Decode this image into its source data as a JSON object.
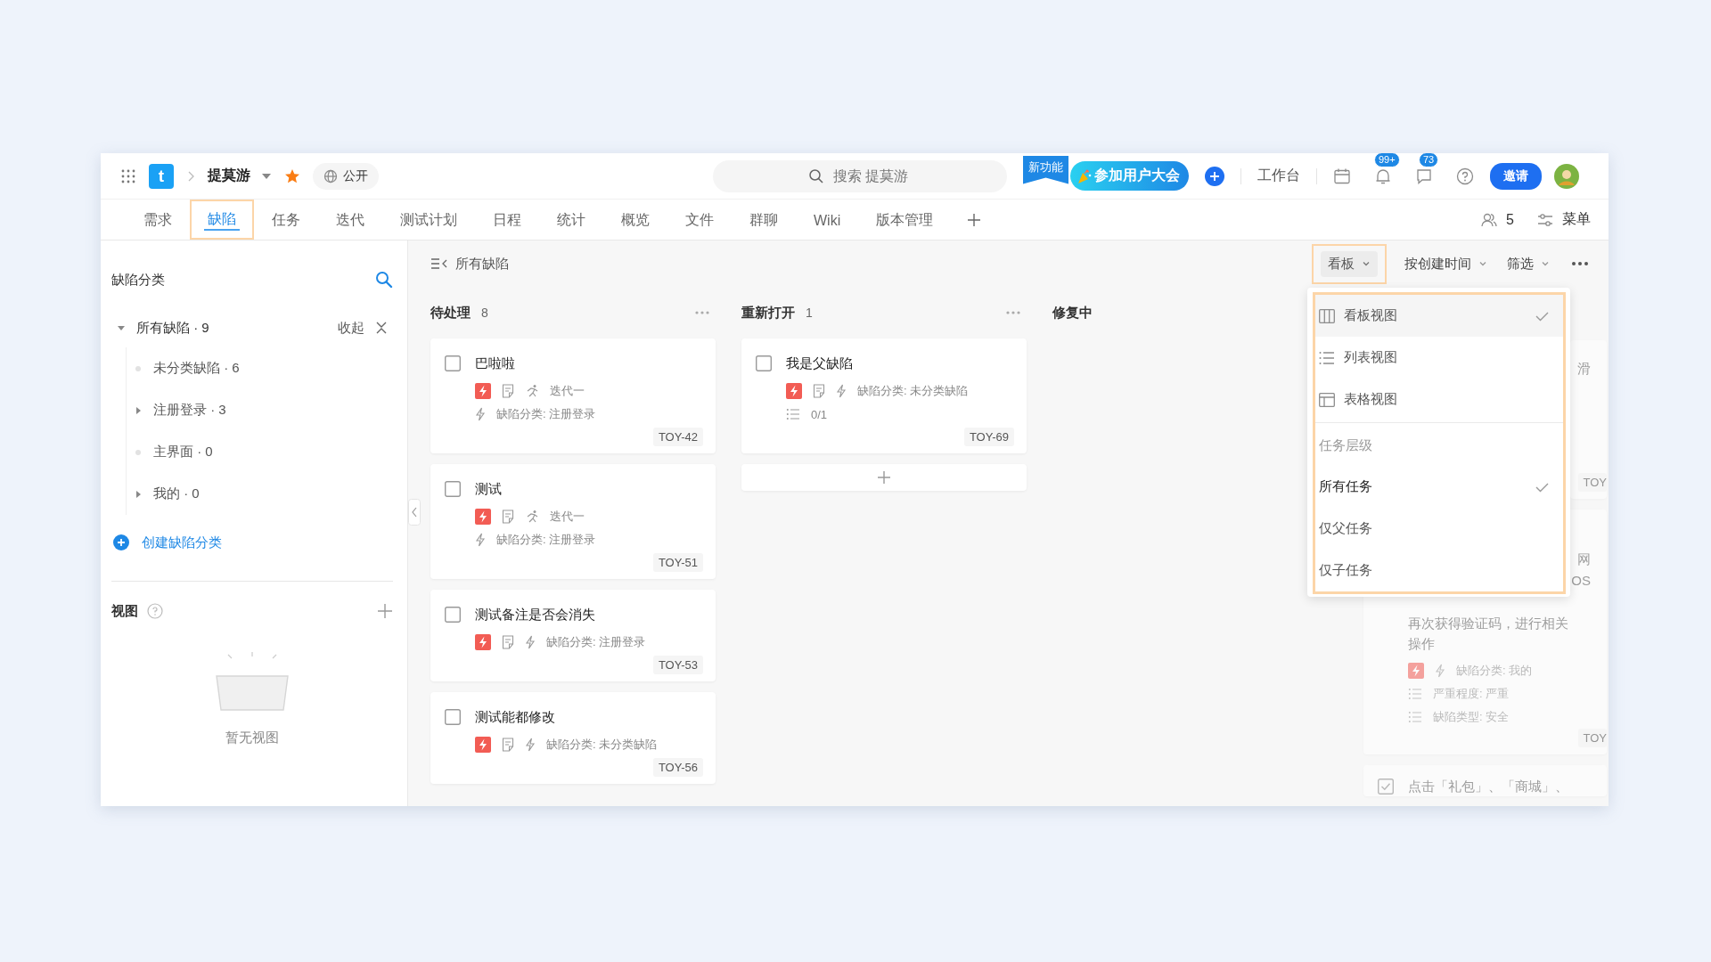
{
  "topbar": {
    "logo": "t",
    "project": "提莫游",
    "starred": true,
    "visibility": "公开",
    "search": {
      "placeholder": "搜索 提莫游"
    },
    "promo_ribbon": "新功能",
    "promo": "参加用户大会",
    "workbench": "工作台",
    "notifications": "99+",
    "messages": "73",
    "invite": "邀请"
  },
  "tabs": [
    {
      "label": "需求",
      "selected": false,
      "highlighted": false
    },
    {
      "label": "缺陷",
      "selected": true,
      "highlighted": true
    },
    {
      "label": "任务",
      "selected": false,
      "highlighted": false
    },
    {
      "label": "迭代",
      "selected": false,
      "highlighted": false
    },
    {
      "label": "测试计划",
      "selected": false,
      "highlighted": false
    },
    {
      "label": "日程",
      "selected": false,
      "highlighted": false
    },
    {
      "label": "统计",
      "selected": false,
      "highlighted": false
    },
    {
      "label": "概览",
      "selected": false,
      "highlighted": false
    },
    {
      "label": "文件",
      "selected": false,
      "highlighted": false
    },
    {
      "label": "群聊",
      "selected": false,
      "highlighted": false
    },
    {
      "label": "Wiki",
      "selected": false,
      "highlighted": false
    },
    {
      "label": "版本管理",
      "selected": false,
      "highlighted": false
    }
  ],
  "members": "5",
  "menu": "菜单",
  "sidebar": {
    "title": "缺陷分类",
    "collapse": "收起",
    "tree": [
      {
        "label": "所有缺陷 · 9",
        "expanded": true,
        "children": [
          {
            "label": "未分类缺陷 · 6"
          },
          {
            "label": "注册登录 · 3",
            "expanded": false
          },
          {
            "label": "主界面 · 0"
          },
          {
            "label": "我的 · 0",
            "expanded": false
          }
        ]
      }
    ],
    "create": "创建缺陷分类",
    "views_title": "视图",
    "views_empty": "暂无视图"
  },
  "board": {
    "title": "所有缺陷",
    "view_button": {
      "label": "看板",
      "highlighted": true
    },
    "sort": "按创建时间",
    "filter": "筛选",
    "columns": [
      {
        "title": "待处理",
        "count": "8",
        "cards": [
          {
            "title": "巴啦啦",
            "checked": false,
            "rows": [
              [
                {
                  "kind": "priority"
                },
                {
                  "kind": "doc"
                },
                {
                  "kind": "sprint",
                  "text": "迭代一"
                }
              ],
              [
                {
                  "kind": "category",
                  "text": "缺陷分类: 注册登录"
                }
              ]
            ],
            "id": "TOY-42"
          },
          {
            "title": "测试",
            "checked": false,
            "rows": [
              [
                {
                  "kind": "priority"
                },
                {
                  "kind": "doc"
                },
                {
                  "kind": "sprint",
                  "text": "迭代一"
                }
              ],
              [
                {
                  "kind": "category",
                  "text": "缺陷分类: 注册登录"
                }
              ]
            ],
            "id": "TOY-51"
          },
          {
            "title": "测试备注是否会消失",
            "checked": false,
            "rows": [
              [
                {
                  "kind": "priority"
                },
                {
                  "kind": "doc"
                },
                {
                  "kind": "category",
                  "text": "缺陷分类: 注册登录"
                }
              ]
            ],
            "id": "TOY-53"
          },
          {
            "title": "测试能都修改",
            "checked": false,
            "rows": [
              [
                {
                  "kind": "priority"
                },
                {
                  "kind": "doc"
                },
                {
                  "kind": "category",
                  "text": "缺陷分类: 未分类缺陷"
                }
              ]
            ],
            "id": "TOY-56"
          }
        ]
      },
      {
        "title": "重新打开",
        "count": "1",
        "add_button": true,
        "cards": [
          {
            "title": "我是父缺陷",
            "checked": false,
            "rows": [
              [
                {
                  "kind": "priority"
                },
                {
                  "kind": "doc"
                },
                {
                  "kind": "category",
                  "text": "缺陷分类: 未分类缺陷"
                }
              ],
              [
                {
                  "kind": "field",
                  "text": "0/1"
                }
              ]
            ],
            "id": "TOY-69"
          }
        ]
      },
      {
        "title": "修复中"
      },
      {
        "faded": true,
        "cards": [
          {
            "lines": [
              {
                "kind": "fragment",
                "text": "滑"
              }
            ],
            "id": "TOY"
          },
          {
            "lines": [
              {
                "kind": "fragment",
                "text": "网"
              },
              {
                "kind": "fragment",
                "text": "OS"
              },
              {
                "kind": "line",
                "text": "再次获得验证码，进行相关"
              },
              {
                "kind": "line",
                "text": "操作"
              }
            ],
            "rows": [
              [
                {
                  "kind": "priority"
                },
                {
                  "kind": "category",
                  "text": "缺陷分类: 我的"
                }
              ],
              [
                {
                  "kind": "field",
                  "text": "严重程度: 严重"
                }
              ],
              [
                {
                  "kind": "field",
                  "text": "缺陷类型: 安全"
                }
              ]
            ],
            "id": "TOY"
          },
          {
            "checked": true,
            "lines": [
              {
                "kind": "line",
                "text": "点击「礼包」、「商城」、"
              }
            ]
          }
        ]
      }
    ],
    "dropdown": {
      "highlighted": true,
      "views": [
        {
          "kind": "board",
          "label": "看板视图",
          "selected": true
        },
        {
          "kind": "list",
          "label": "列表视图",
          "selected": false
        },
        {
          "kind": "table",
          "label": "表格视图",
          "selected": false
        }
      ],
      "level_title": "任务层级",
      "levels": [
        {
          "label": "所有任务",
          "selected": true
        },
        {
          "label": "仅父任务",
          "selected": false
        },
        {
          "label": "仅子任务",
          "selected": false
        }
      ]
    }
  }
}
